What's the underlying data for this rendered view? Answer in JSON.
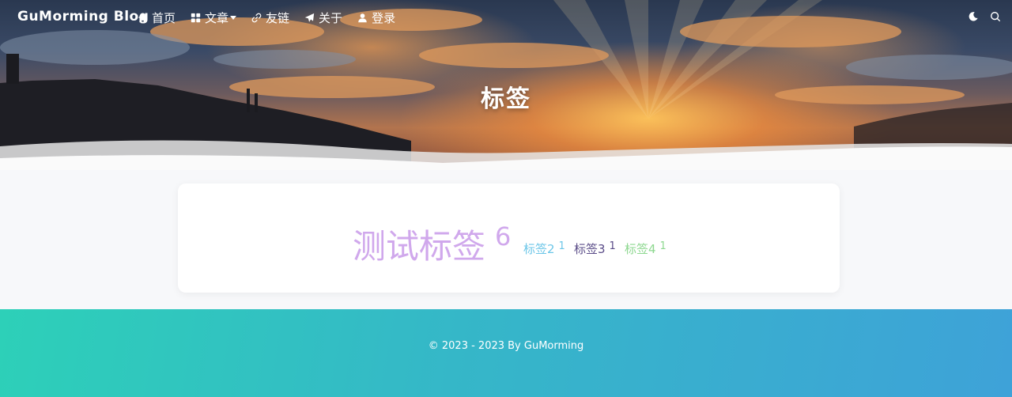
{
  "nav": {
    "brand": "GuMorming Blog",
    "items": [
      {
        "label": "首页",
        "icon": "home-icon"
      },
      {
        "label": "文章",
        "icon": "grid-icon",
        "dropdown": true
      },
      {
        "label": "友链",
        "icon": "link-icon"
      },
      {
        "label": "关于",
        "icon": "paper-plane-icon"
      },
      {
        "label": "登录",
        "icon": "user-icon"
      }
    ],
    "right_icons": [
      "moon-icon",
      "search-icon"
    ]
  },
  "hero": {
    "title": "标签"
  },
  "tags": [
    {
      "name": "测试标签",
      "count": "6",
      "color": "#d0a8ec"
    },
    {
      "name": "标签2",
      "count": "1",
      "color": "#6cc6e8"
    },
    {
      "name": "标签3",
      "count": "1",
      "color": "#5a4c88"
    },
    {
      "name": "标签4",
      "count": "1",
      "color": "#8ed890"
    }
  ],
  "footer": {
    "text": "© 2023 - 2023 By GuMorming"
  }
}
